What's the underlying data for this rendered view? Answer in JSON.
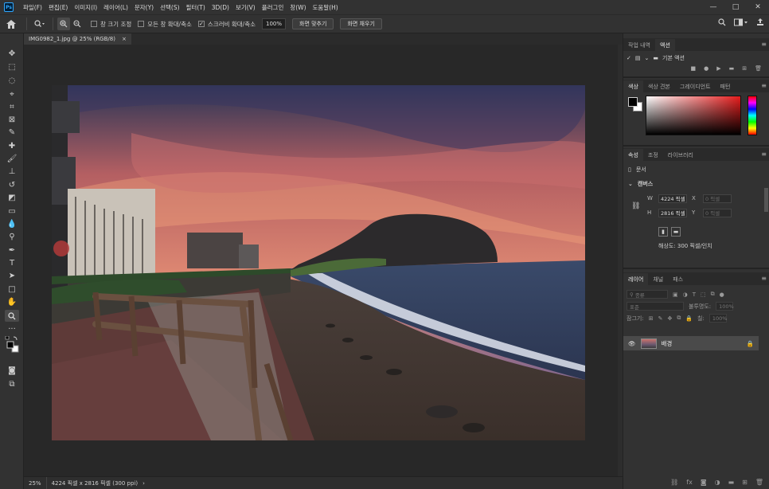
{
  "app": {
    "logo": "Ps"
  },
  "menu": [
    "파일(F)",
    "편집(E)",
    "이미지(I)",
    "레이어(L)",
    "문자(Y)",
    "선택(S)",
    "필터(T)",
    "3D(D)",
    "보기(V)",
    "플러그인",
    "창(W)",
    "도움말(H)"
  ],
  "window": {
    "minimize": "—",
    "maximize": "□",
    "close": "✕"
  },
  "options": {
    "resize_windows": "창 크기 조정",
    "zoom_all": "모든 창 확대/축소",
    "scrubby_zoom": "스크러비 확대/축소",
    "zoom_value": "100%",
    "fit_screen": "화면 맞추기",
    "fill_screen": "화면 채우기"
  },
  "document": {
    "tab_title": "IMG0982_1.jpg @ 25% (RGB/8)",
    "close": "×",
    "status_zoom": "25%",
    "status_info": "4224 픽셀 x 2816 픽셀 (300 ppi)",
    "status_arrow": "›"
  },
  "panels": {
    "history_actions": {
      "tabs": [
        "작업 내역",
        "액션"
      ],
      "active": 1,
      "set_name": "기본 액션"
    },
    "color": {
      "tabs": [
        "색상",
        "색상 견본",
        "그레이디언트",
        "패턴"
      ],
      "active": 0,
      "foreground": "#000000",
      "background": "#ffffff"
    },
    "properties": {
      "tabs": [
        "속성",
        "조정",
        "라이브러리"
      ],
      "active": 0,
      "doc_label": "문서",
      "canvas_label": "캔버스",
      "width_label": "W",
      "width_value": "4224 픽셀",
      "height_label": "H",
      "height_value": "2816 픽셀",
      "x_label": "X",
      "x_placeholder": "0 픽셀",
      "y_label": "Y",
      "y_placeholder": "0 픽셀",
      "resolution": "해상도: 300 픽셀/인치"
    },
    "layers": {
      "tabs": [
        "레이어",
        "채널",
        "패스"
      ],
      "active": 0,
      "filter": "종류",
      "blend": "표준",
      "opacity_label": "불투명도:",
      "opacity_value": "100%",
      "lock_label": "잠그기:",
      "fill_label": "칠:",
      "fill_value": "100%",
      "layer_name": "배경"
    }
  }
}
